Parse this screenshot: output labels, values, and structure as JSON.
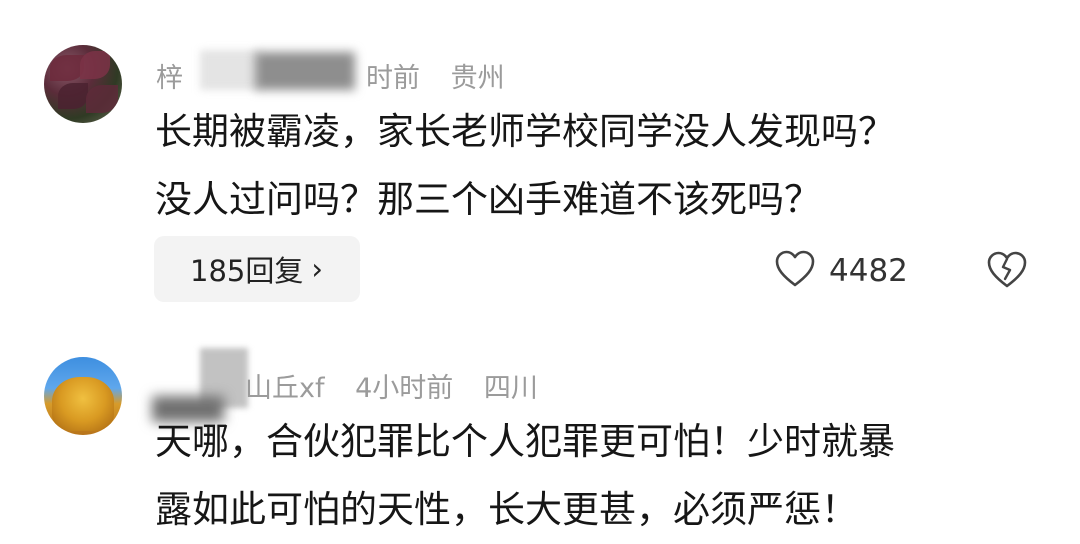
{
  "comments": [
    {
      "meta_left": "梓",
      "meta_right": "时前",
      "location": "贵州",
      "lines": [
        "长期被霸凌，家长老师学校同学没人发现吗？",
        "没人过问吗？那三个凶手难道不该死吗？"
      ],
      "reply_label": "185回复",
      "reply_chevron": "›",
      "likes": "4482",
      "like_icon": "heart-outline-icon",
      "dislike_icon": "broken-heart-icon"
    },
    {
      "username_visible": "山丘xf",
      "time": "4小时前",
      "location": "四川",
      "lines": [
        "天哪，合伙犯罪比个人犯罪更可怕！少时就暴",
        "露如此可怕的天性，长大更甚，必须严惩！"
      ]
    }
  ],
  "colors": {
    "meta_text": "#9b9b9b",
    "body_text": "#161616",
    "pill_bg": "#f3f3f3"
  }
}
